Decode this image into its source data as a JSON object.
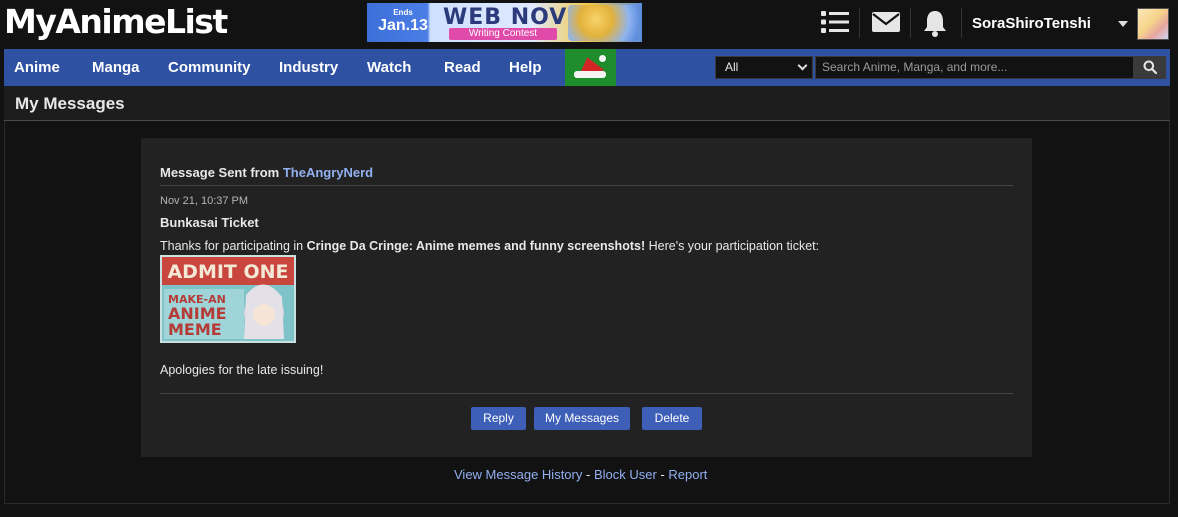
{
  "header": {
    "logo": "MyAnimeList",
    "banner": {
      "ends_label": "Ends",
      "ends_date": "Jan.13",
      "title": "WEB NOVEL",
      "subtitle": "Writing Contest"
    },
    "username": "SoraShiroTenshi"
  },
  "nav": {
    "items": [
      "Anime",
      "Manga",
      "Community",
      "Industry",
      "Watch",
      "Read",
      "Help"
    ],
    "search": {
      "category": "All",
      "placeholder": "Search Anime, Manga, and more..."
    }
  },
  "page": {
    "title": "My Messages"
  },
  "message": {
    "header_prefix": "Message Sent from ",
    "sender": "TheAngryNerd",
    "date": "Nov 21, 10:37 PM",
    "subject": "Bunkasai Ticket",
    "body_prefix": "Thanks for participating in ",
    "body_club": "Cringe Da Cringe: Anime memes and funny screenshots!",
    "body_suffix": " Here's your participation ticket:",
    "ticket": {
      "line1": "ADMIT ONE",
      "line2": "MAKE-AN",
      "line3": "ANIME",
      "line4": "MEME"
    },
    "closing": "Apologies for the late issuing!"
  },
  "buttons": {
    "reply": "Reply",
    "my_messages": "My Messages",
    "delete": "Delete"
  },
  "footer": {
    "history": "View Message History",
    "block": "Block User",
    "report": "Report",
    "separator": " - "
  },
  "colors": {
    "nav_blue": "#2e51a2",
    "button_blue": "#3e5fb8",
    "link_blue": "#92b0f0",
    "santa_green": "#1f8d2b"
  }
}
